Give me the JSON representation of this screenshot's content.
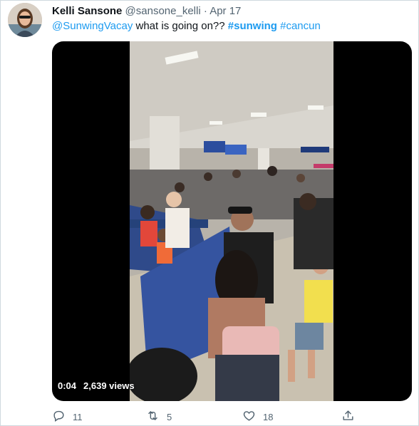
{
  "tweet": {
    "author_name": "Kelli Sansone",
    "handle": "@sansone_kelli",
    "separator": "·",
    "date": "Apr 17",
    "text_mention": "@SunwingVacay",
    "text_body": " what is going on?? ",
    "hashtag_1": "#sunwing",
    "hashtag_2": "#cancun"
  },
  "video": {
    "time": "0:04",
    "views": "2,639 views"
  },
  "actions": {
    "replies": "11",
    "retweets": "5",
    "likes": "18"
  },
  "icons": [
    "reply-icon",
    "retweet-icon",
    "like-icon",
    "share-icon"
  ],
  "colors": {
    "link": "#1d9bf0",
    "muted": "#536471",
    "border": "#cfd9de"
  }
}
